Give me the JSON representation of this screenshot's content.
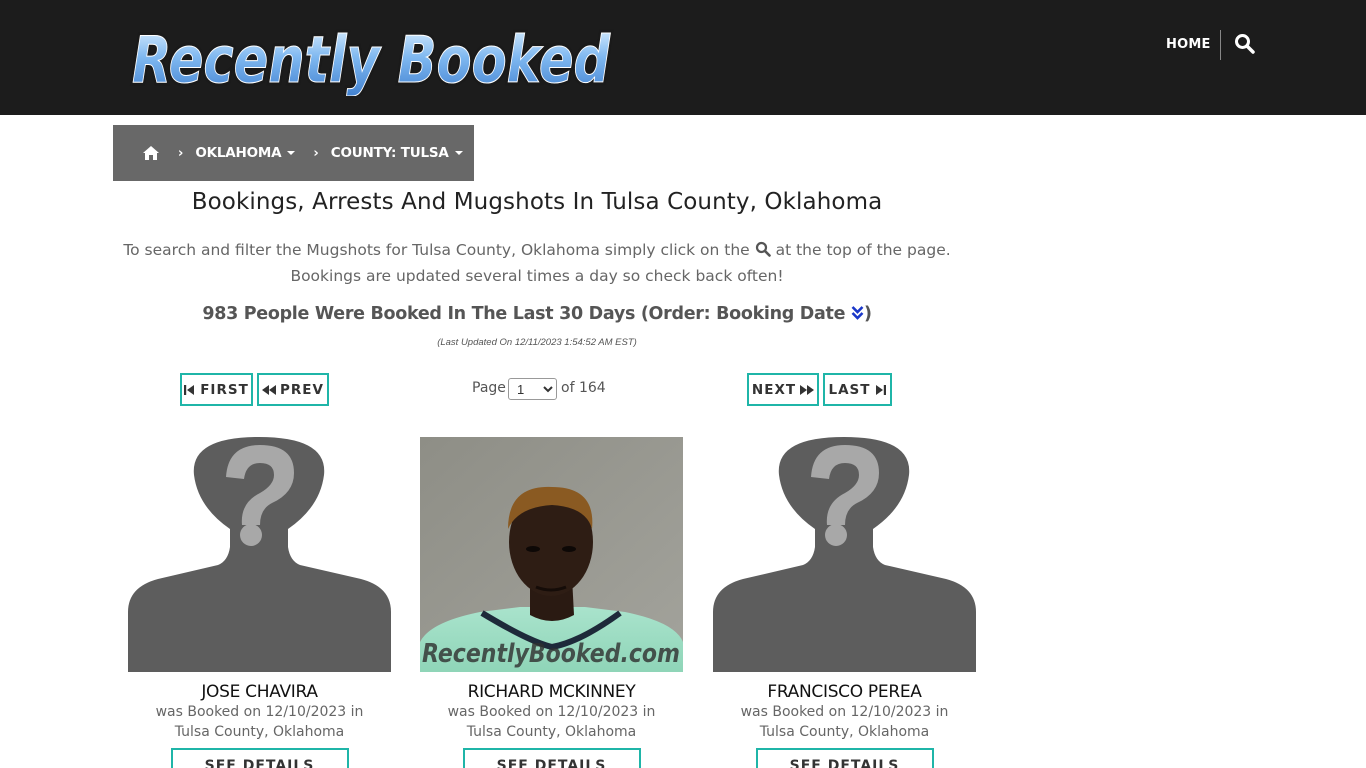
{
  "header": {
    "logo_text": "Recently Booked",
    "nav_home": "HOME",
    "search_icon": "search-icon"
  },
  "breadcrumb": {
    "home_icon": "home-icon",
    "state": "OKLAHOMA",
    "county": "COUNTY: TULSA"
  },
  "main": {
    "title": "Bookings, Arrests And Mugshots In Tulsa County, Oklahoma",
    "intro_before_icon": "To search and filter the Mugshots for Tulsa County, Oklahoma simply click on the",
    "intro_after_icon": "at the top of the page.",
    "intro_line2": "Bookings are updated several times a day so check back often!",
    "count_text": "983 People Were Booked In The Last 30 Days (Order: Booking Date",
    "count_close": ")",
    "last_updated": "(Last Updated On 12/11/2023 1:54:52 AM EST)"
  },
  "pager": {
    "first": "FIRST",
    "prev": "PREV",
    "next": "NEXT",
    "last": "LAST",
    "page_label": "Page",
    "current_page": "1",
    "of_label": "of 164"
  },
  "cards": [
    {
      "name": "JOSE CHAVIRA",
      "booked": "was Booked on 12/10/2023 in",
      "location": "Tulsa County, Oklahoma",
      "button": "SEE DETAILS",
      "photo": "placeholder-silhouette"
    },
    {
      "name": "RICHARD MCKINNEY",
      "booked": "was Booked on 12/10/2023 in",
      "location": "Tulsa County, Oklahoma",
      "button": "SEE DETAILS",
      "photo": "mugshot",
      "watermark": "RecentlyBooked.com"
    },
    {
      "name": "FRANCISCO PEREA",
      "booked": "was Booked on 12/10/2023 in",
      "location": "Tulsa County, Oklahoma",
      "button": "SEE DETAILS",
      "photo": "placeholder-silhouette"
    }
  ],
  "colors": {
    "header_bg": "#1c1c1c",
    "breadcrumb_bg": "#686868",
    "button_border": "#1fb5a8",
    "silhouette": "#5d5d5d"
  }
}
